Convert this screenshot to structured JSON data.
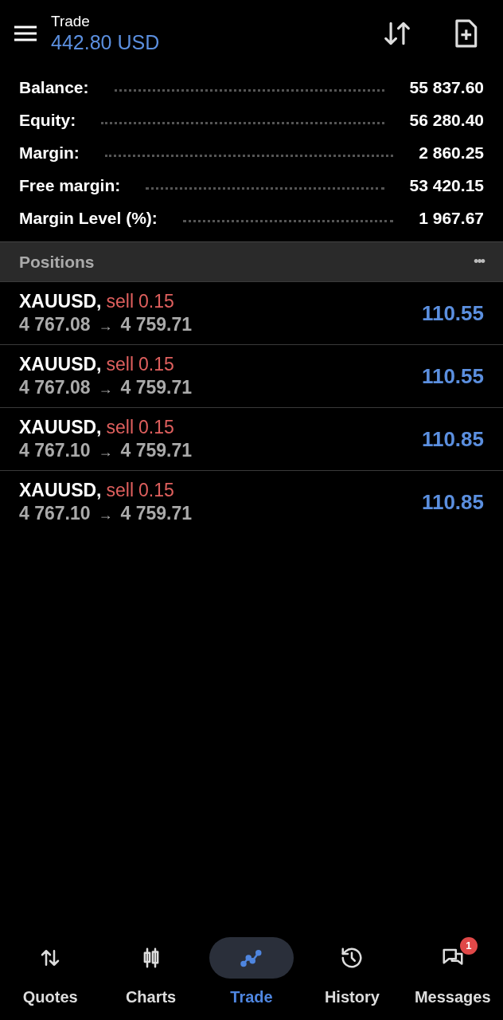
{
  "header": {
    "title": "Trade",
    "profit": "442.80 USD"
  },
  "summary": [
    {
      "label": "Balance:",
      "value": "55 837.60"
    },
    {
      "label": "Equity:",
      "value": "56 280.40"
    },
    {
      "label": "Margin:",
      "value": "2 860.25"
    },
    {
      "label": "Free margin:",
      "value": "53 420.15"
    },
    {
      "label": "Margin Level (%):",
      "value": "1 967.67"
    }
  ],
  "positions": {
    "title": "Positions",
    "more": "•••",
    "rows": [
      {
        "symbol": "XAUUSD,",
        "side": "sell",
        "volume": "0.15",
        "open_price": "4 767.08",
        "arrow": "→",
        "current_price": "4 759.71",
        "profit": "110.55"
      },
      {
        "symbol": "XAUUSD,",
        "side": "sell",
        "volume": "0.15",
        "open_price": "4 767.08",
        "arrow": "→",
        "current_price": "4 759.71",
        "profit": "110.55"
      },
      {
        "symbol": "XAUUSD,",
        "side": "sell",
        "volume": "0.15",
        "open_price": "4 767.10",
        "arrow": "→",
        "current_price": "4 759.71",
        "profit": "110.85"
      },
      {
        "symbol": "XAUUSD,",
        "side": "sell",
        "volume": "0.15",
        "open_price": "4 767.10",
        "arrow": "→",
        "current_price": "4 759.71",
        "profit": "110.85"
      }
    ]
  },
  "nav": [
    {
      "kind": "quotes",
      "label": "Quotes",
      "selected": false
    },
    {
      "kind": "charts",
      "label": "Charts",
      "selected": false
    },
    {
      "kind": "trade",
      "label": "Trade",
      "selected": true
    },
    {
      "kind": "history",
      "label": "History",
      "selected": false
    },
    {
      "kind": "messages",
      "label": "Messages",
      "selected": false,
      "badge": "1"
    }
  ]
}
